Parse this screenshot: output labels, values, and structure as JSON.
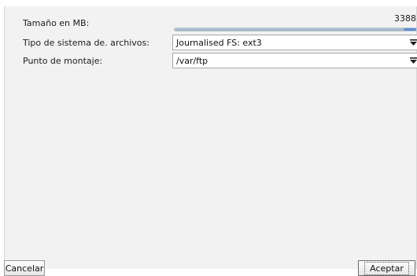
{
  "form": {
    "size_label": "Tamaño en MB:",
    "size_value": "3388",
    "size_fraction": 0.96,
    "fs_label": "Tipo de sistema de. archivos:",
    "fs_value": "Journalised FS: ext3",
    "mount_label": "Punto de montaje:",
    "mount_value": "/var/ftp"
  },
  "buttons": {
    "cancel": "Cancelar",
    "ok": "Aceptar"
  },
  "icons": {
    "dropdown": "dropdown-arrow-icon"
  },
  "colors": {
    "slider_handle": "#5a8fd1",
    "panel_bg": "#f2f2f2"
  }
}
